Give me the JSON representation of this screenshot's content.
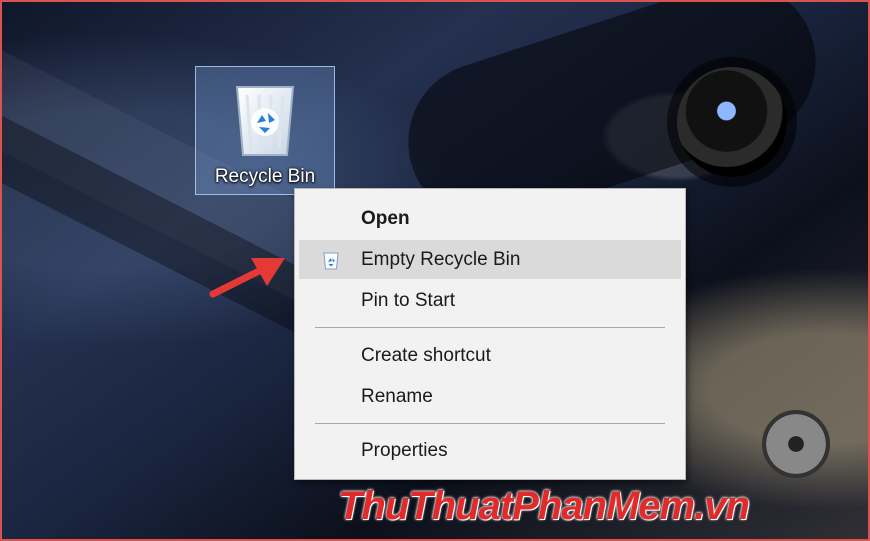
{
  "desktop": {
    "recycle_bin_label": "Recycle Bin",
    "recycle_bin_icon": "recycle-bin-icon"
  },
  "context_menu": {
    "items": [
      {
        "label": "Open",
        "bold": true
      },
      {
        "label": "Empty Recycle Bin",
        "icon": "recycle-bin-small-icon",
        "highlighted": true
      },
      {
        "label": "Pin to Start"
      },
      {
        "label": "Create shortcut"
      },
      {
        "label": "Rename"
      },
      {
        "label": "Properties"
      }
    ]
  },
  "annotation": {
    "arrow_color": "#e53935",
    "arrow_icon": "red-arrow-icon"
  },
  "watermark": {
    "parts": [
      "ThuThuat",
      "PhanMem",
      ".vn"
    ]
  },
  "colors": {
    "menu_background": "#f2f2f2",
    "menu_hover": "#dadada",
    "border_accent": "#d9534f"
  }
}
